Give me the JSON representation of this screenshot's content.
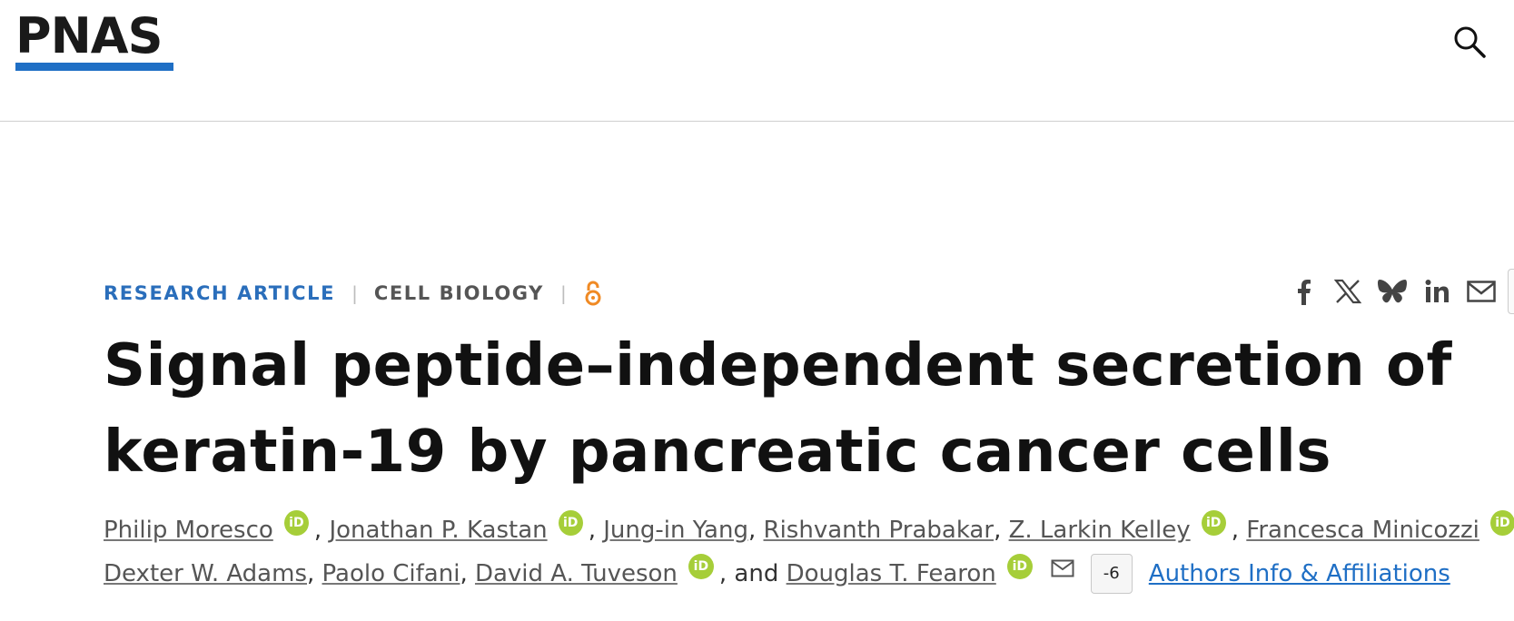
{
  "header": {
    "logo_text": "PNAS",
    "search_icon": "search-icon"
  },
  "article": {
    "type": "RESEARCH ARTICLE",
    "subject": "CELL BIOLOGY",
    "open_access_icon": "open-access-icon",
    "title": "Signal peptide–independent secretion of keratin-19 by pancreatic cancer cells"
  },
  "share": {
    "icons": [
      "facebook-icon",
      "x-icon",
      "bluesky-icon",
      "linkedin-icon",
      "email-icon"
    ]
  },
  "authors": {
    "line1": [
      "Philip Moresco",
      "Jonathan P. Kastan",
      "Jung-in Yang",
      "Rishvanth Prabakar",
      "Z. Larkin Kelley",
      "Francesca Minicozzi"
    ],
    "line2": [
      "Dexter W. Adams",
      "Paolo Cifani",
      "David A. Tuveson",
      "Douglas T. Fearon"
    ],
    "orcid_label": "iD",
    "comma": ",",
    "and": ", and",
    "counter": "-6",
    "affiliations_link": "Authors Info & Affiliations"
  },
  "colors": {
    "brand_blue": "#1f6fc5",
    "orcid_green": "#a6ce39",
    "open_access_orange": "#f08a24"
  }
}
